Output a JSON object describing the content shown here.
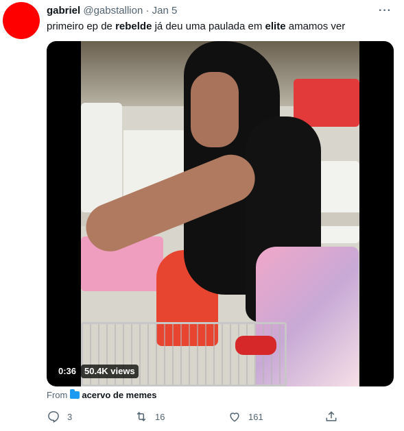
{
  "tweet": {
    "author_name": "gabriel",
    "author_handle": "@gabstallion",
    "separator": "·",
    "date": "Jan 5",
    "text_parts": [
      "primeiro ep de ",
      "rebelde",
      " já deu uma paulada em ",
      "elite",
      " amamos ver"
    ],
    "more_label": "···",
    "avatar_color": "#ff0000"
  },
  "video": {
    "duration": "0:36",
    "views": "50.4K views"
  },
  "source": {
    "from_label": "From",
    "folder_icon": "folder-icon",
    "name": "acervo de memes"
  },
  "actions": {
    "reply_count": "3",
    "retweet_count": "16",
    "like_count": "161"
  }
}
